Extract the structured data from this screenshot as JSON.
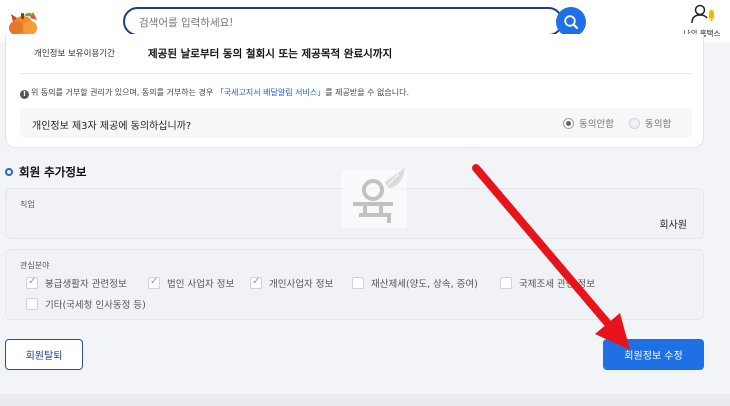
{
  "header": {
    "search_placeholder": "검색어를 입력하세요!",
    "mypage_label": "나의 홈택스"
  },
  "consent": {
    "retention_label": "개인정보 보유이용기간",
    "retention_value": "제공된 날로부터 동의 철회시 또는 제공목적 완료시까지",
    "notice_prefix": "위 동의를 거부할 권리가 있으며, 동의를 거부하는 경우 ",
    "notice_link": "「국세고지서 배달알림 서비스」",
    "notice_suffix": "를 제공받을 수 없습니다.",
    "question": "개인정보 제3자 제공에 동의하십니까?",
    "option_disagree": "동의안함",
    "option_agree": "동의함",
    "selected": "동의안함"
  },
  "section": {
    "title": "회원 추가정보"
  },
  "job": {
    "label": "직업",
    "value": "회사원"
  },
  "interests": {
    "label": "관심분야",
    "items": [
      {
        "label": "봉급생활자 관련정보",
        "checked": true
      },
      {
        "label": "법인 사업자 정보",
        "checked": true
      },
      {
        "label": "개인사업자 정보",
        "checked": true
      },
      {
        "label": "재산제세(양도, 상속, 증여)",
        "checked": false
      },
      {
        "label": "국제조세 관련 정보",
        "checked": false
      },
      {
        "label": "기타(국세청 인사동정 등)",
        "checked": false
      }
    ]
  },
  "buttons": {
    "withdraw": "회원탈퇴",
    "edit": "회원정보 수정"
  },
  "colors": {
    "primary": "#1f6fe5",
    "navy": "#1a3e8f",
    "annotation_arrow": "#e8141b"
  }
}
